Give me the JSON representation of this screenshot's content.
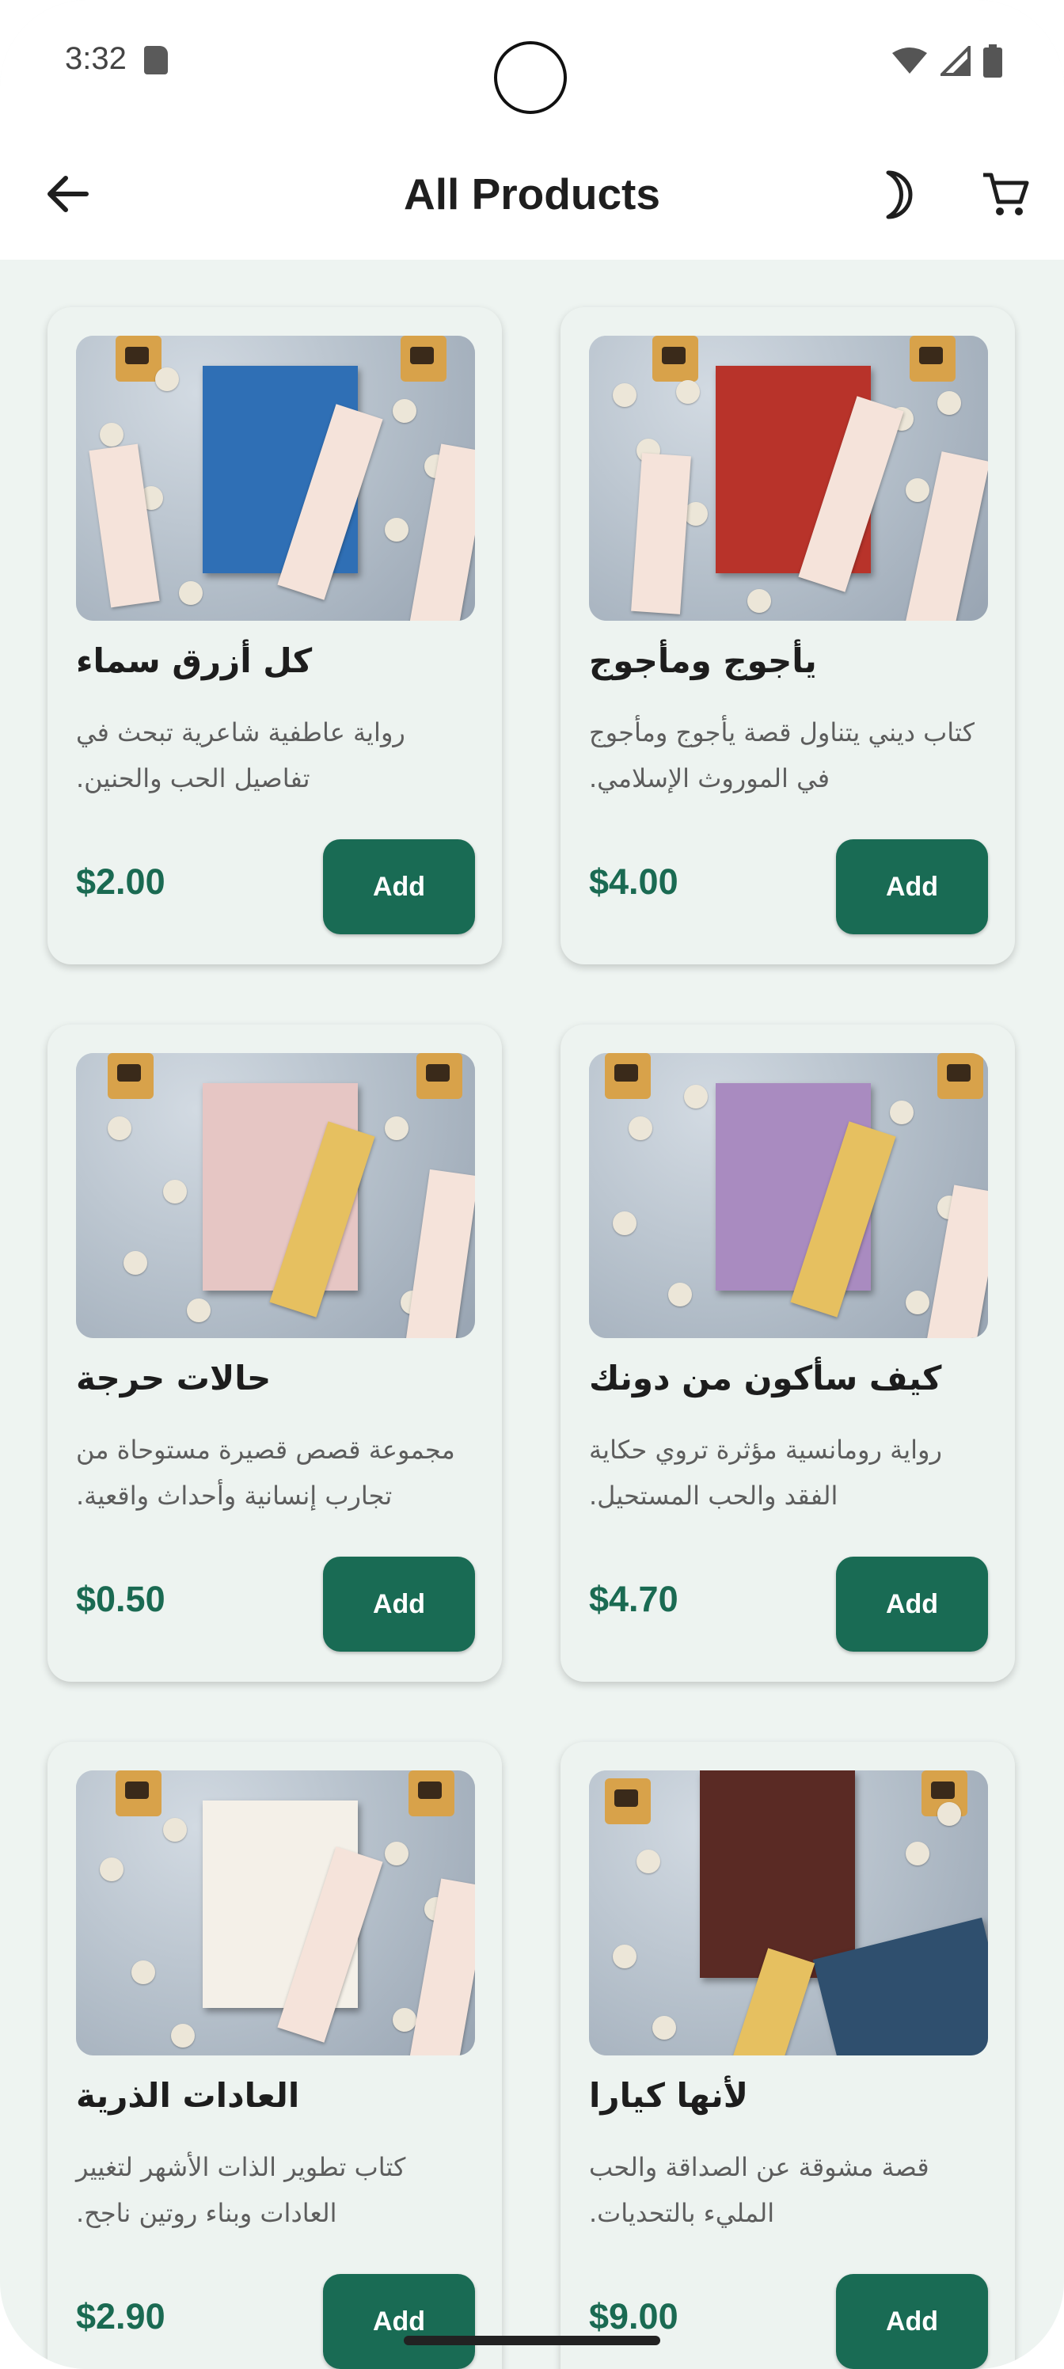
{
  "status_bar": {
    "time": "3:32"
  },
  "app_bar": {
    "title": "All Products",
    "back_icon": "arrow-left-icon",
    "theme_icon": "moon-icon",
    "cart_icon": "cart-icon"
  },
  "colors": {
    "primary": "#196b54",
    "price": "#1a6a52",
    "background": "#eef4f1",
    "card": "#edf3f0"
  },
  "products": [
    {
      "title": "يأجوج ومأجوج",
      "description": "كتاب ديني يتناول قصة يأجوج ومأجوج في الموروث الإسلامي.",
      "price": "$4.00",
      "add_label": "Add",
      "cover_color": "#b8332a"
    },
    {
      "title": "كل أزرق سماء",
      "description": "رواية عاطفية شاعرية تبحث في تفاصيل الحب والحنين.",
      "price": "$2.00",
      "add_label": "Add",
      "cover_color": "#2f6fb5"
    },
    {
      "title": "كيف سأكون من دونك",
      "description": "رواية رومانسية مؤثرة تروي حكاية الفقد والحب المستحيل.",
      "price": "$4.70",
      "add_label": "Add",
      "cover_color": "#a98bc0"
    },
    {
      "title": "حالات حرجة",
      "description": "مجموعة قصص قصيرة مستوحاة من تجارب إنسانية وأحداث واقعية.",
      "price": "$0.50",
      "add_label": "Add",
      "cover_color": "#e6c6c4"
    },
    {
      "title": "لأنها كيارا",
      "description": "قصة مشوقة عن الصداقة والحب المليء بالتحديات.",
      "price": "$9.00",
      "add_label": "Add",
      "cover_color": "#5a2a24"
    },
    {
      "title": "العادات الذرية",
      "description": "كتاب تطوير الذات الأشهر لتغيير العادات وبناء روتين ناجح.",
      "price": "$2.90",
      "add_label": "Add",
      "cover_color": "#f4f0e8"
    }
  ]
}
